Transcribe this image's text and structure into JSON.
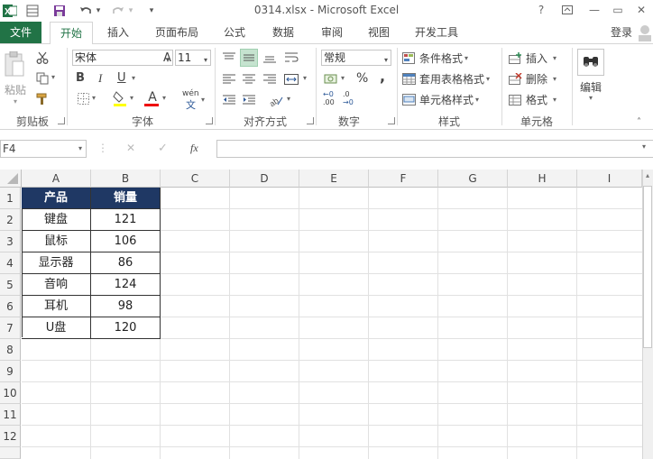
{
  "window": {
    "title": "0314.xlsx - Microsoft Excel",
    "help": "?",
    "minimize": "—",
    "restore": "▭",
    "close": "✕"
  },
  "quick_access": {
    "excel_logo": "X",
    "undo_dd": "▾",
    "redo_dd": "▾",
    "customize": "▾"
  },
  "tabs": [
    "文件",
    "开始",
    "插入",
    "页面布局",
    "公式",
    "数据",
    "审阅",
    "视图",
    "开发工具"
  ],
  "account": "登录",
  "ribbon": {
    "clipboard": {
      "paste": "粘贴",
      "label": "剪贴板"
    },
    "font": {
      "name": "宋体",
      "size": "11",
      "bold": "B",
      "italic": "I",
      "underline": "U",
      "grow": "A",
      "shrink": "A",
      "font_color": "A",
      "phonetic": "wén",
      "phonetic2": "文",
      "label": "字体"
    },
    "alignment": {
      "label": "对齐方式"
    },
    "number": {
      "format": "常规",
      "percent": "%",
      "comma": ",",
      "inc": ".00",
      "dec": ".0",
      "inc_top": "←0",
      "dec_top": "→0",
      "label": "数字"
    },
    "styles": {
      "conditional": "条件格式",
      "table": "套用表格格式",
      "cell_styles": "单元格样式",
      "label": "样式"
    },
    "cells": {
      "insert": "插入",
      "delete": "删除",
      "format": "格式",
      "label": "单元格"
    },
    "editing": {
      "label": "编辑"
    }
  },
  "formula_bar": {
    "name_box": "F4",
    "cancel": "✕",
    "enter": "✓",
    "fx": "fx",
    "value": ""
  },
  "columns": [
    "A",
    "B",
    "C",
    "D",
    "E",
    "F",
    "G",
    "H",
    "I"
  ],
  "rows": [
    "1",
    "2",
    "3",
    "4",
    "5",
    "6",
    "7",
    "8",
    "9",
    "10",
    "11",
    "12"
  ],
  "table": {
    "headers": [
      "产品",
      "销量"
    ],
    "rows": [
      [
        "键盘",
        "121"
      ],
      [
        "鼠标",
        "106"
      ],
      [
        "显示器",
        "86"
      ],
      [
        "音响",
        "124"
      ],
      [
        "耳机",
        "98"
      ],
      [
        "U盘",
        "120"
      ]
    ]
  },
  "colors": {
    "excel_green": "#217346",
    "header_fill": "#1f3864"
  }
}
